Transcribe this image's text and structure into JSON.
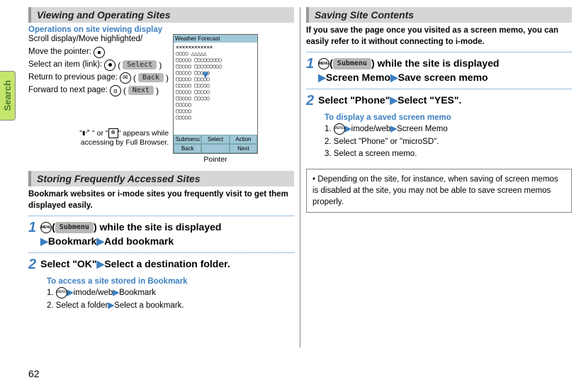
{
  "sidetab": "Search",
  "pagenum": "62",
  "left": {
    "sec1_title": "Viewing and Operating Sites",
    "ops_title": "Operations on site viewing display",
    "scroll_move": "Scroll display/Move highlighted/",
    "move_pointer": "Move the pointer:",
    "select_item": "Select an item (link):",
    "select_btn": "Select",
    "return_prev": "Return to previous page:",
    "back_btn": "Back",
    "forward_next": "Forward to next page:",
    "next_btn": "Next",
    "appears_note_a": "\"",
    "appears_note_b": "\" or \"",
    "appears_note_c": "\" appears while",
    "appears_note_d": "accessing by Full Browser.",
    "pointer_label": "Pointer",
    "phone_title": "Weather Forecast",
    "phone_soft": {
      "submenu": "Submenu",
      "back": "Back",
      "select": "Select",
      "action": "Action",
      "next": "Next"
    },
    "wx": [
      "××××××××××××",
      "○○○○ △△△△△",
      "▢○○○○ ▢○○○○○○○○",
      "▢○○○○ ▢○○○○○○○○",
      "▢○○○○ ▢○○○○",
      "▢○○○○ ▢○○○○",
      "▢○○○○ ▢○○○○",
      "▢○○○○ ▢○○○○",
      "▢○○○○ ▢○○○○",
      "▢○○○○",
      "▢○○○○",
      "▢○○○○"
    ],
    "sec2_title": "Storing Frequently Accessed Sites",
    "sec2_intro": "Bookmark websites or i-mode sites you frequently visit to get them displayed easily.",
    "step1_btn": "Submenu",
    "step1_body_a": "while the site is displayed",
    "step1_body_b": "Bookmark",
    "step1_body_c": "Add bookmark",
    "step2_a": "Select \"OK\"",
    "step2_b": "Select a destination folder.",
    "access_title": "To access a site stored in Bookmark",
    "sub1_a": "imode/web",
    "sub1_b": "Bookmark",
    "sub2": "Select a folder",
    "sub2_b": "Select a bookmark."
  },
  "right": {
    "sec_title": "Saving Site Contents",
    "intro": "If you save the page once you visited as a screen memo, you can easily refer to it without connecting to i-mode.",
    "step1_btn": "Submenu",
    "step1_a": "while the site is displayed",
    "step1_b": "Screen Memo",
    "step1_c": "Save screen memo",
    "step2_a": "Select \"Phone\"",
    "step2_b": "Select \"YES\".",
    "display_title": "To display a saved screen memo",
    "d1_a": "imode/web",
    "d1_b": "Screen Memo",
    "d2": "Select \"Phone\" or \"microSD\".",
    "d3": "Select a screen memo.",
    "note": "Depending on the site, for instance, when saving of screen memos is disabled at the site, you may not be able to save screen memos properly."
  }
}
